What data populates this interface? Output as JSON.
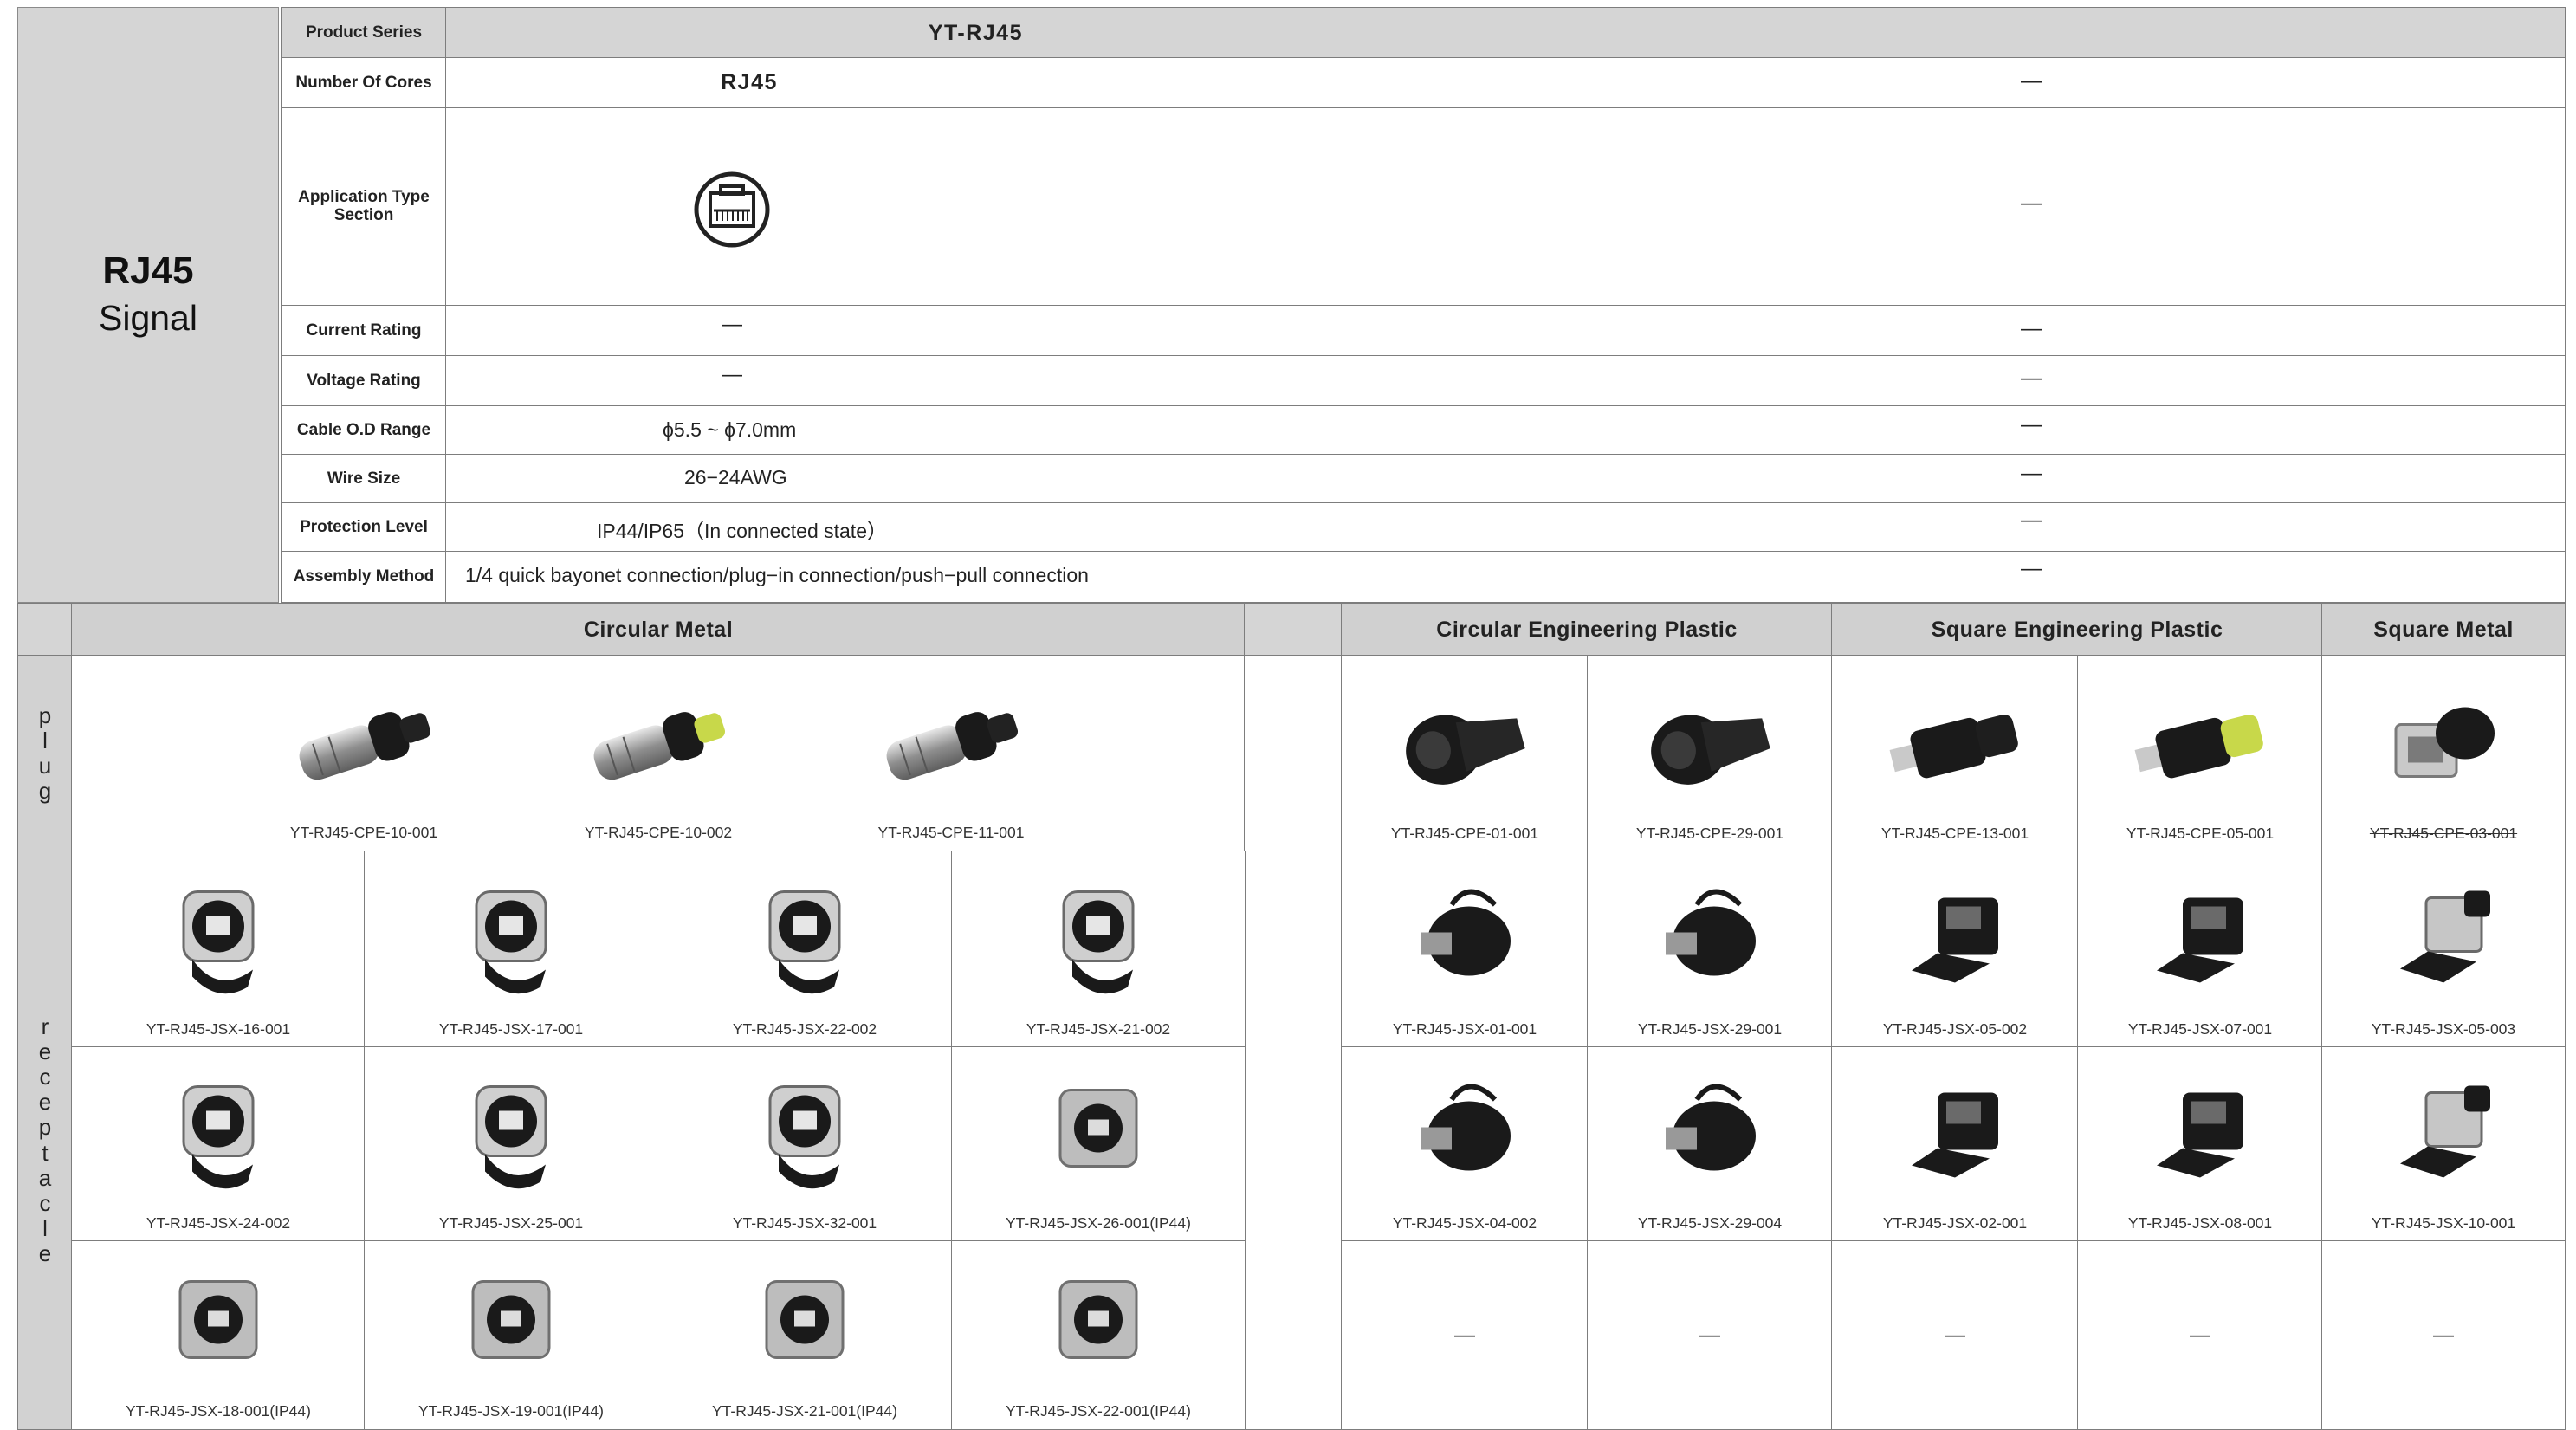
{
  "side_title": {
    "line1": "RJ45",
    "line2": "Signal"
  },
  "specs": [
    {
      "label": "Product Series",
      "left": "YT-RJ45",
      "right": ""
    },
    {
      "label": "Number Of Cores",
      "left": "RJ45",
      "right": "—"
    },
    {
      "label": "Application Type Section",
      "left": "",
      "right": "—",
      "left_icon": "rj45-port-icon"
    },
    {
      "label": "Current Rating",
      "left": "—",
      "right": "—"
    },
    {
      "label": "Voltage Rating",
      "left": "—",
      "right": "—"
    },
    {
      "label": "Cable O.D Range",
      "left": "ϕ5.5 ~ ϕ7.0mm",
      "right": "—"
    },
    {
      "label": "Wire Size",
      "left": "26−24AWG",
      "right": "—"
    },
    {
      "label": "Protection Level",
      "left": "IP44/IP65（In connected state）",
      "right": "—"
    },
    {
      "label": "Assembly Method",
      "left": "1/4 quick bayonet connection/plug−in connection/push−pull connection",
      "right": "—"
    }
  ],
  "groups": [
    "Circular Metal",
    "Circular Engineering Plastic",
    "Square Engineering Plastic",
    "Square Metal"
  ],
  "row_labels": {
    "plug": "plug",
    "receptacle": "receptacle"
  },
  "metal_plugs": [
    "YT-RJ45-CPE-10-001",
    "YT-RJ45-CPE-10-002",
    "YT-RJ45-CPE-11-001"
  ],
  "metal_receptacles": [
    [
      "YT-RJ45-JSX-16-001",
      "YT-RJ45-JSX-17-001",
      "YT-RJ45-JSX-22-002",
      "YT-RJ45-JSX-21-002"
    ],
    [
      "YT-RJ45-JSX-24-002",
      "YT-RJ45-JSX-25-001",
      "YT-RJ45-JSX-32-001",
      "YT-RJ45-JSX-26-001(IP44)"
    ],
    [
      "YT-RJ45-JSX-18-001(IP44)",
      "YT-RJ45-JSX-19-001(IP44)",
      "YT-RJ45-JSX-21-001(IP44)",
      "YT-RJ45-JSX-22-001(IP44)"
    ]
  ],
  "right_grid": [
    [
      "YT-RJ45-CPE-01-001",
      "YT-RJ45-CPE-29-001",
      "YT-RJ45-CPE-13-001",
      "YT-RJ45-CPE-05-001",
      "YT-RJ45-CPE-03-001"
    ],
    [
      "YT-RJ45-JSX-01-001",
      "YT-RJ45-JSX-29-001",
      "YT-RJ45-JSX-05-002",
      "YT-RJ45-JSX-07-001",
      "YT-RJ45-JSX-05-003"
    ],
    [
      "YT-RJ45-JSX-04-002",
      "YT-RJ45-JSX-29-004",
      "YT-RJ45-JSX-02-001",
      "YT-RJ45-JSX-08-001",
      "YT-RJ45-JSX-10-001"
    ],
    [
      "—",
      "—",
      "—",
      "—",
      "—"
    ]
  ],
  "colors": {
    "grey_fill": "#d5d5d5",
    "border": "#7d7d7d",
    "accent_tip": "#c8d84a"
  }
}
